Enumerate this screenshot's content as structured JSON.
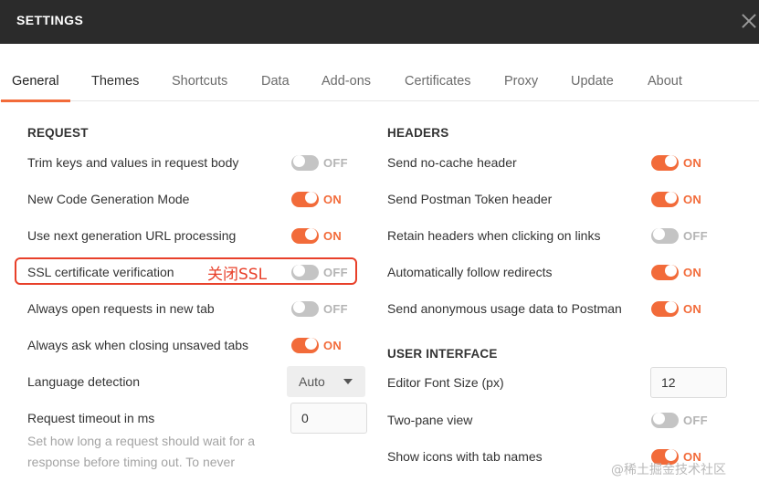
{
  "window": {
    "title": "SETTINGS"
  },
  "tabs": [
    "General",
    "Themes",
    "Shortcuts",
    "Data",
    "Add-ons",
    "Certificates",
    "Proxy",
    "Update",
    "About"
  ],
  "request": {
    "title": "REQUEST",
    "trim": {
      "label": "Trim keys and values in request body",
      "state": "OFF"
    },
    "codegen": {
      "label": "New Code Generation Mode",
      "state": "ON"
    },
    "url_processing": {
      "label": "Use next generation URL processing",
      "state": "ON"
    },
    "ssl": {
      "label": "SSL certificate verification",
      "state": "OFF"
    },
    "new_tab": {
      "label": "Always open requests in new tab",
      "state": "OFF"
    },
    "ask_close": {
      "label": "Always ask when closing unsaved tabs",
      "state": "ON"
    },
    "language": {
      "label": "Language detection",
      "value": "Auto"
    },
    "timeout": {
      "label": "Request timeout in ms",
      "value": "0",
      "help_line1": "Set how long a request should wait for a",
      "help_line2": "response before timing out. To never"
    }
  },
  "headers": {
    "title": "HEADERS",
    "no_cache": {
      "label": "Send no-cache header",
      "state": "ON"
    },
    "postman_token": {
      "label": "Send Postman Token header",
      "state": "ON"
    },
    "retain_headers": {
      "label": "Retain headers when clicking on links",
      "state": "OFF"
    },
    "follow_redirects": {
      "label": "Automatically follow redirects",
      "state": "ON"
    },
    "usage_data": {
      "label": "Send anonymous usage data to Postman",
      "state": "ON"
    }
  },
  "ui": {
    "title": "USER INTERFACE",
    "font_size": {
      "label": "Editor Font Size (px)",
      "value": "12"
    },
    "two_pane": {
      "label": "Two-pane view",
      "state": "OFF"
    },
    "tab_icons": {
      "label": "Show icons with tab names",
      "state": "ON"
    }
  },
  "annotation": {
    "text": "关闭SSL",
    "color": "#e8402a"
  },
  "watermark": "@稀土掘金技术社区",
  "colors": {
    "accent": "#f26b3a",
    "titlebar": "#2b2b2b",
    "toggle_off": "#c4c4c4"
  }
}
